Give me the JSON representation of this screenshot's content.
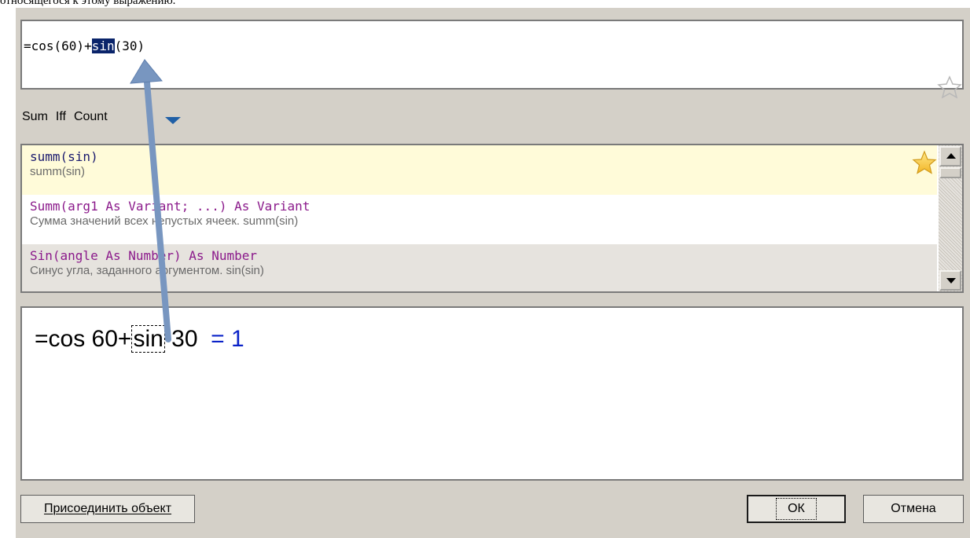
{
  "caption": "относящегося к этому выражению.",
  "formula": {
    "before": "=cos(60)+",
    "selected": "sin",
    "after": "(30)"
  },
  "tabs": [
    "Sum",
    "Iff",
    "Count"
  ],
  "suggestions": [
    {
      "signature": "summ(sin)",
      "description": "summ(sin)"
    },
    {
      "signature": "Summ(arg1 As Variant; ...) As Variant",
      "description": "Сумма значений всех непустых ячеек. summ(sin)"
    },
    {
      "signature": "Sin(angle As Number) As Number",
      "description": "Синус угла, заданного аргументом. sin(sin)"
    }
  ],
  "preview": {
    "prefix": "=cos 60+",
    "focus": "sin",
    "suffix": " 30 ",
    "result": " = 1"
  },
  "buttons": {
    "attach": "Присоединить объект",
    "ok": "ОК",
    "cancel": "Отмена"
  },
  "colors": {
    "dialog_bg": "#d4d0c8",
    "selection_bg": "#0a246a",
    "highlight_row": "#fffbd9",
    "signature_purple": "#8b1a8b",
    "result_blue": "#0a22c8",
    "annotation_arrow": "#7896c0"
  },
  "icons": {
    "favorite": "star-outline-icon",
    "favorited": "star-filled-icon",
    "tabs_more": "triangle-down-icon"
  }
}
